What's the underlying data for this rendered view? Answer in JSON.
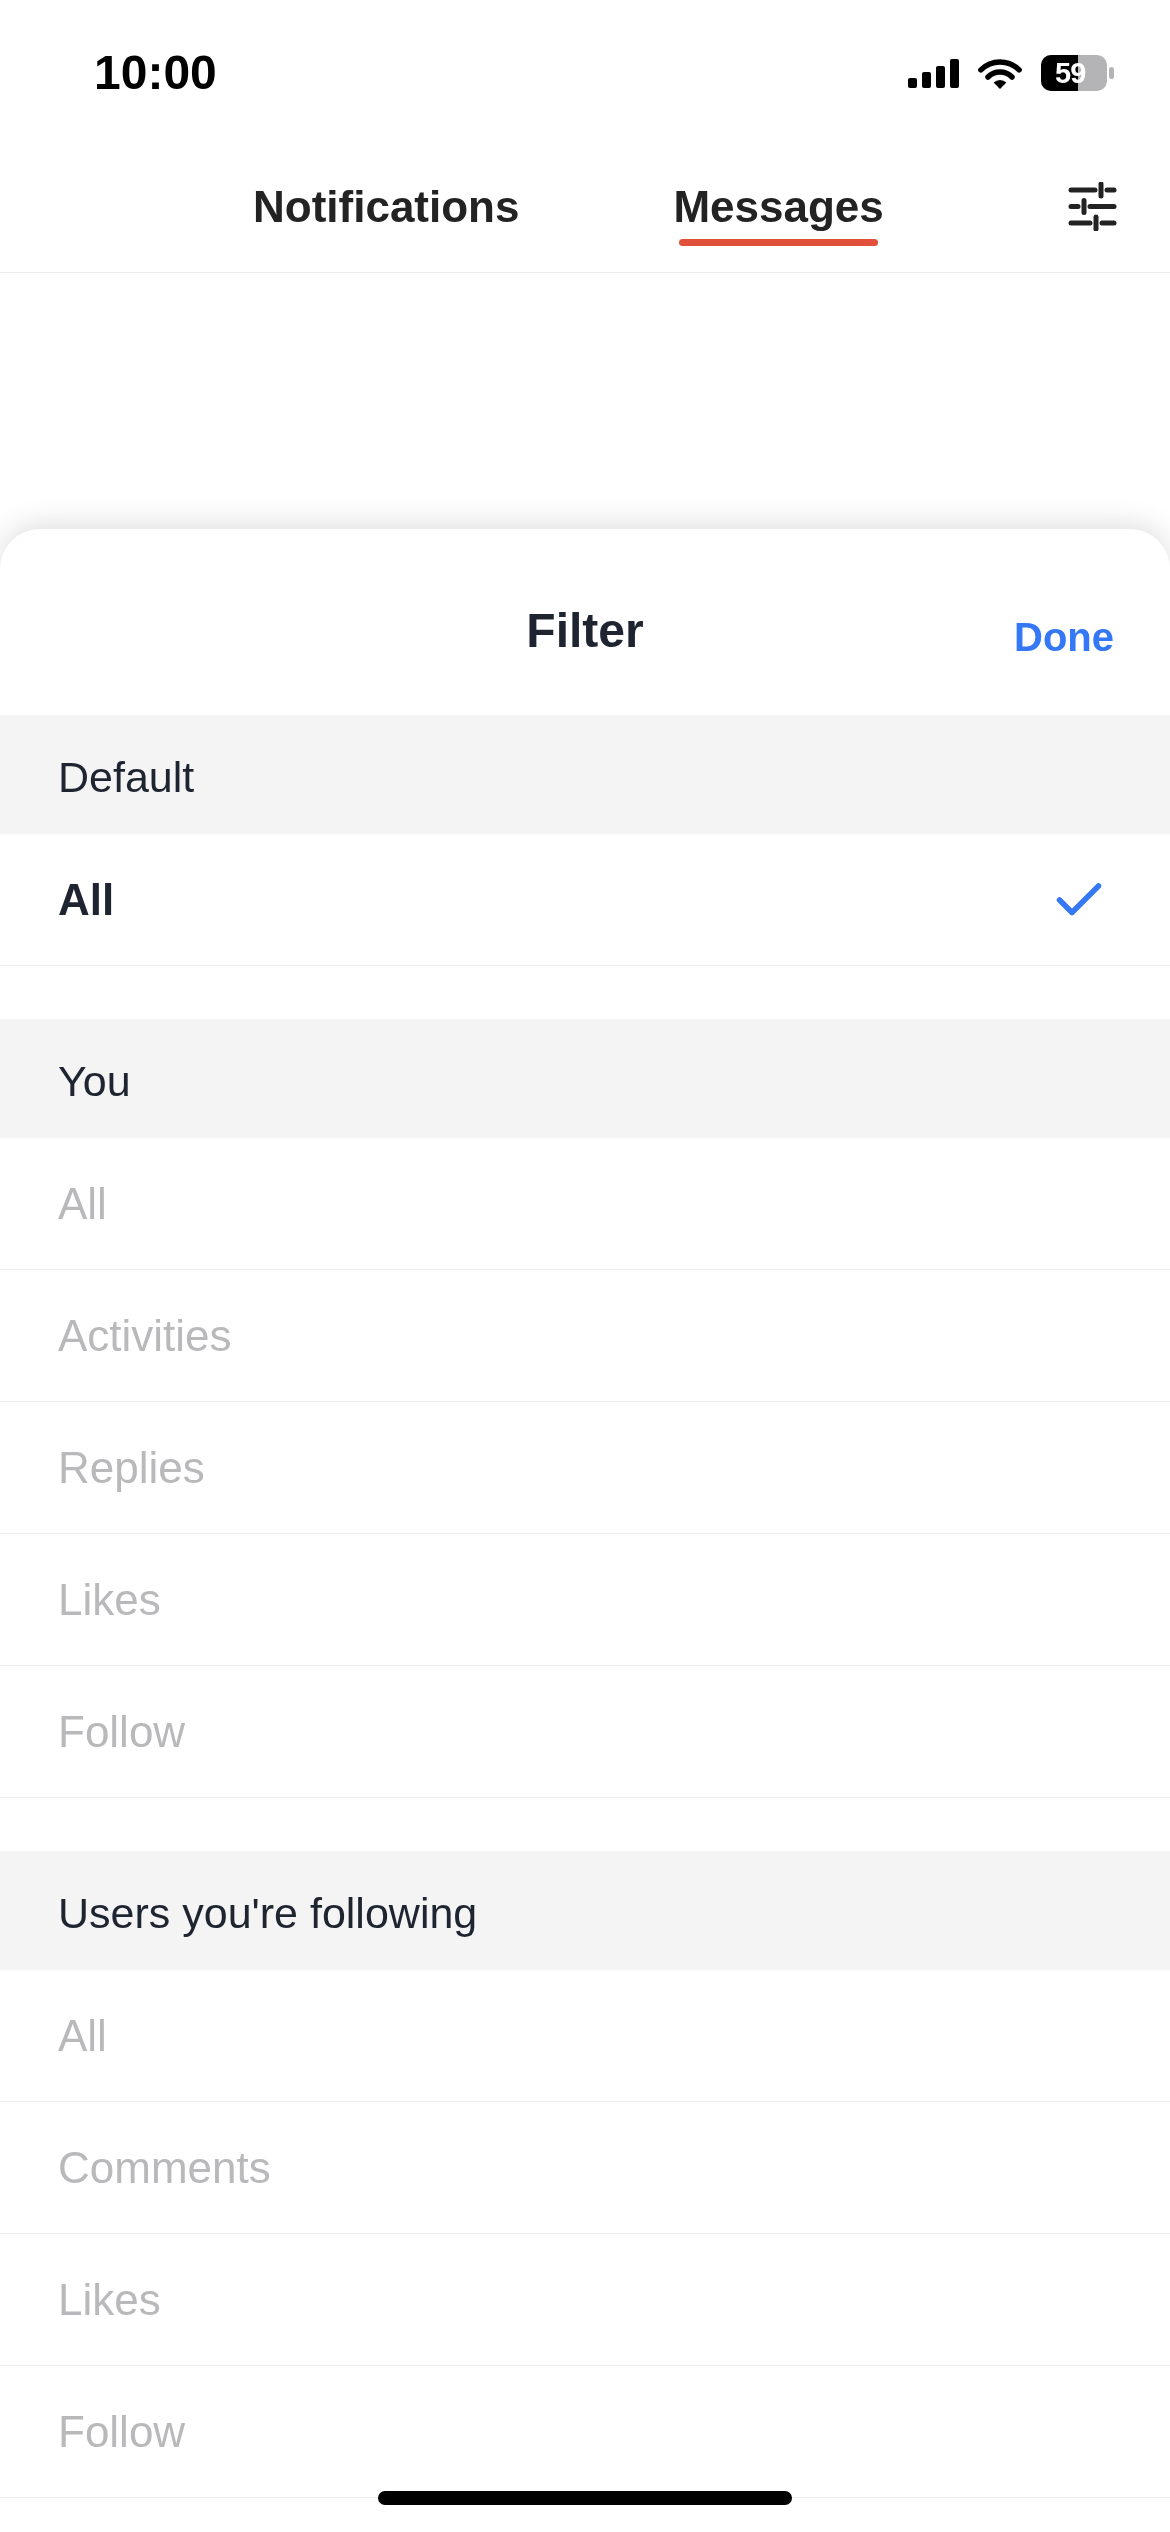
{
  "status_bar": {
    "time": "10:00",
    "battery": "59"
  },
  "tabs": [
    {
      "label": "Notifications",
      "selected": false
    },
    {
      "label": "Messages",
      "selected": true
    }
  ],
  "sheet": {
    "title": "Filter",
    "done": "Done",
    "sections": [
      {
        "title": "Default",
        "options": [
          {
            "label": "All",
            "selected": true,
            "disabled": false
          }
        ]
      },
      {
        "title": "You",
        "options": [
          {
            "label": "All",
            "selected": false,
            "disabled": true
          },
          {
            "label": "Activities",
            "selected": false,
            "disabled": true
          },
          {
            "label": "Replies",
            "selected": false,
            "disabled": true
          },
          {
            "label": "Likes",
            "selected": false,
            "disabled": true
          },
          {
            "label": "Follow",
            "selected": false,
            "disabled": true
          }
        ]
      },
      {
        "title": "Users you're following",
        "options": [
          {
            "label": "All",
            "selected": false,
            "disabled": true
          },
          {
            "label": "Comments",
            "selected": false,
            "disabled": true
          },
          {
            "label": "Likes",
            "selected": false,
            "disabled": true
          },
          {
            "label": "Follow",
            "selected": false,
            "disabled": true
          }
        ]
      }
    ]
  }
}
